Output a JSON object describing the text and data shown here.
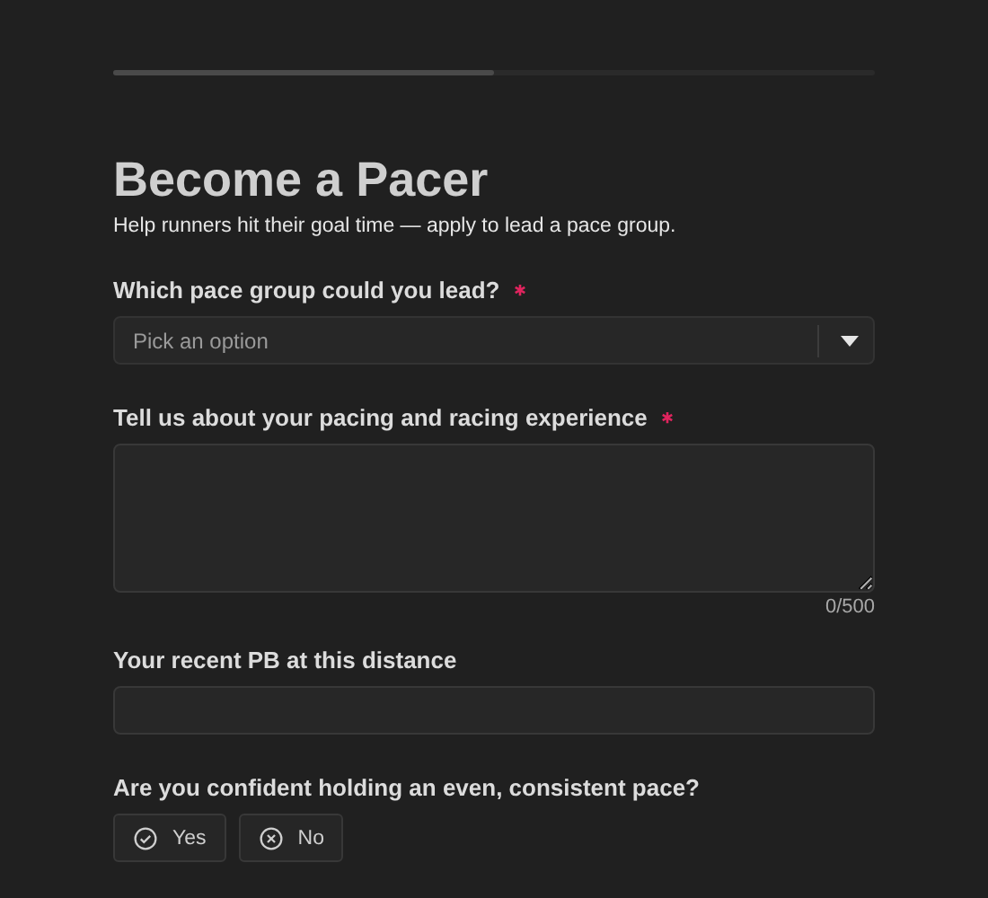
{
  "progress": {
    "level": 0.5
  },
  "title": "Become a Pacer",
  "subtitle": "Help runners hit their goal time — apply to lead a pace group.",
  "fields": [
    {
      "kind": "select",
      "label": "Which pace group could you lead?",
      "required": true,
      "placeholder": "Pick an option"
    },
    {
      "kind": "textarea",
      "label": "Tell us about your pacing and racing experience",
      "required": true,
      "counter": "0/500"
    },
    {
      "kind": "text",
      "label": "Your recent PB at this distance",
      "required": false
    },
    {
      "kind": "choice",
      "label": "Are you confident holding an even, consistent pace?",
      "required": false,
      "options": [
        {
          "label": "Yes",
          "kind": "check",
          "selected": false
        },
        {
          "label": "No",
          "kind": "cross",
          "selected": false
        }
      ]
    }
  ]
}
